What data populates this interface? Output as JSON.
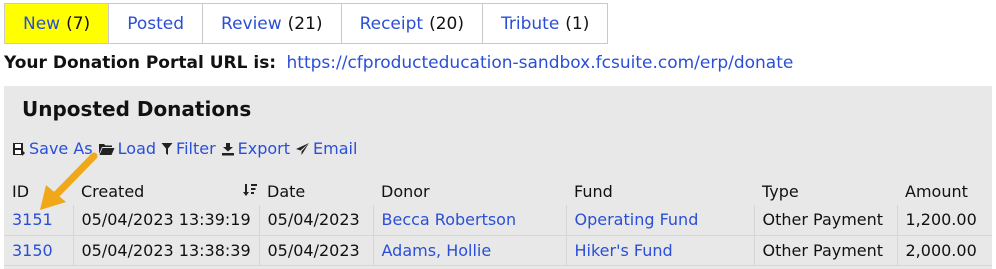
{
  "tabs": [
    {
      "label": "New",
      "count": "(7)",
      "active": true
    },
    {
      "label": "Posted",
      "count": "",
      "active": false
    },
    {
      "label": "Review",
      "count": "(21)",
      "active": false
    },
    {
      "label": "Receipt",
      "count": "(20)",
      "active": false
    },
    {
      "label": "Tribute",
      "count": "(1)",
      "active": false
    }
  ],
  "portal": {
    "label": "Your Donation Portal URL is:",
    "url": "https://cfproducteducation-sandbox.fcsuite.com/erp/donate"
  },
  "panel": {
    "title": "Unposted Donations"
  },
  "toolbar": {
    "save_as": "Save As",
    "load": "Load",
    "filter": "Filter",
    "export": "Export",
    "email": "Email"
  },
  "table": {
    "headers": [
      "ID",
      "Created",
      "Date",
      "Donor",
      "Fund",
      "Type",
      "Amount"
    ],
    "rows": [
      {
        "id": "3151",
        "created": "05/04/2023 13:39:19",
        "date": "05/04/2023",
        "donor": "Becca Robertson",
        "fund": "Operating Fund",
        "type": "Other Payment",
        "amount": "1,200.00"
      },
      {
        "id": "3150",
        "created": "05/04/2023 13:38:39",
        "date": "05/04/2023",
        "donor": "Adams, Hollie",
        "fund": "Hiker's Fund",
        "type": "Other Payment",
        "amount": "2,000.00"
      }
    ]
  },
  "colors": {
    "active_tab": "#ffff00",
    "link": "#2a4fd6",
    "panel_bg": "#e8e8e8",
    "arrow": "#f0a818"
  },
  "icons": {
    "save_as": "save-icon",
    "load": "folder-open-icon",
    "filter": "filter-icon",
    "export": "export-icon",
    "email": "send-icon",
    "sort": "sort-descending-icon",
    "annotation": "arrow-pointer-icon"
  }
}
